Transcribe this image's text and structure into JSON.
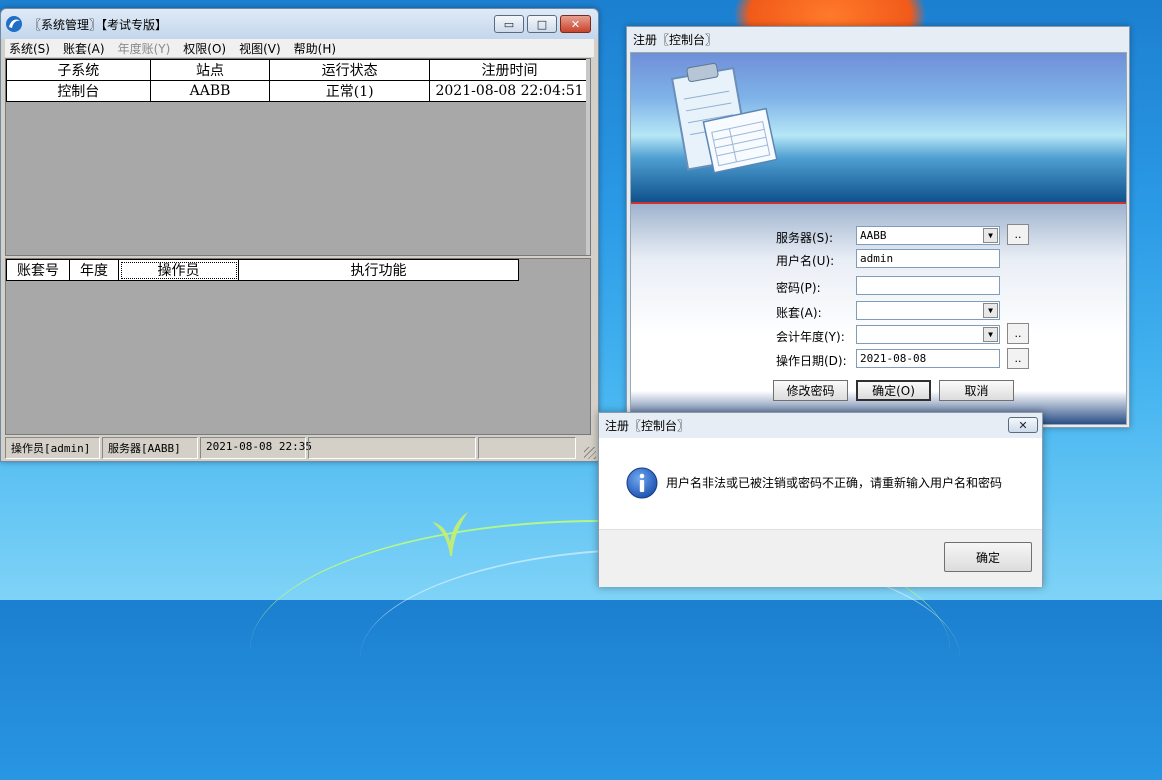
{
  "system_manager": {
    "title": "〖系统管理〗【考试专版】",
    "menu": [
      {
        "label": "系统(S)",
        "disabled": false
      },
      {
        "label": "账套(A)",
        "disabled": false
      },
      {
        "label": "年度账(Y)",
        "disabled": true
      },
      {
        "label": "权限(O)",
        "disabled": false
      },
      {
        "label": "视图(V)",
        "disabled": false
      },
      {
        "label": "帮助(H)",
        "disabled": false
      }
    ],
    "subsystem_table": {
      "headers": [
        "子系统",
        "站点",
        "运行状态",
        "注册时间"
      ],
      "rows": [
        [
          "控制台",
          "AABB",
          "正常(1)",
          "2021-08-08 22:04:51"
        ]
      ]
    },
    "task_table": {
      "headers": [
        "账套号",
        "年度",
        "操作员",
        "执行功能"
      ]
    },
    "status": {
      "operator": "操作员[admin]",
      "server": "服务器[AABB]",
      "datetime": "2021-08-08 22:35"
    }
  },
  "login_dialog": {
    "title": "注册〖控制台〗",
    "labels": {
      "server": "服务器(S):",
      "username": "用户名(U):",
      "password": "密码(P):",
      "account": "账套(A):",
      "fiscal_year": "会计年度(Y):",
      "operation_date": "操作日期(D):"
    },
    "values": {
      "server": "AABB",
      "username": "admin",
      "password": "",
      "account": "",
      "fiscal_year": "",
      "operation_date": "2021-08-08"
    },
    "buttons": {
      "change_password": "修改密码",
      "ok": "确定(O)",
      "cancel": "取消",
      "browse": ".."
    }
  },
  "error_box": {
    "title": "注册〖控制台〗",
    "message": "用户名非法或已被注销或密码不正确，请重新输入用户名和密码",
    "ok": "确定"
  }
}
